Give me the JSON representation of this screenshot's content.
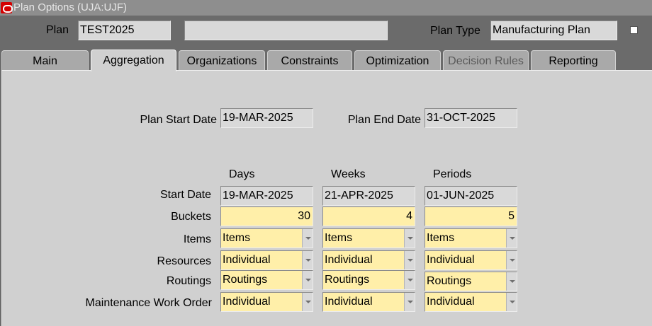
{
  "window": {
    "title": "Plan Options (UJA:UJF)"
  },
  "header": {
    "plan_label": "Plan",
    "plan_value": "TEST2025",
    "description_value": "",
    "plan_type_label": "Plan Type",
    "plan_type_value": "Manufacturing Plan"
  },
  "tabs": [
    {
      "label": "Main",
      "active": false,
      "disabled": false
    },
    {
      "label": "Aggregation",
      "active": true,
      "disabled": false
    },
    {
      "label": "Organizations",
      "active": false,
      "disabled": false
    },
    {
      "label": "Constraints",
      "active": false,
      "disabled": false
    },
    {
      "label": "Optimization",
      "active": false,
      "disabled": false
    },
    {
      "label": "Decision Rules",
      "active": false,
      "disabled": true
    },
    {
      "label": "Reporting",
      "active": false,
      "disabled": false
    }
  ],
  "dates": {
    "start_label": "Plan Start Date",
    "start_value": "19-MAR-2025",
    "end_label": "Plan End Date",
    "end_value": "31-OCT-2025"
  },
  "grid": {
    "columns": [
      "Days",
      "Weeks",
      "Periods"
    ],
    "row_labels": {
      "start_date": "Start Date",
      "buckets": "Buckets",
      "items": "Items",
      "resources": "Resources",
      "routings": "Routings",
      "maintenance": "Maintenance Work Order"
    },
    "start_date": [
      "19-MAR-2025",
      "21-APR-2025",
      "01-JUN-2025"
    ],
    "buckets": [
      "30",
      "4",
      "5"
    ],
    "items": [
      "Items",
      "Items",
      "Items"
    ],
    "resources": [
      "Individual",
      "Individual",
      "Individual"
    ],
    "routings": [
      "Routings",
      "Routings",
      "Routings"
    ],
    "maintenance": [
      "Individual",
      "Individual",
      "Individual"
    ]
  }
}
